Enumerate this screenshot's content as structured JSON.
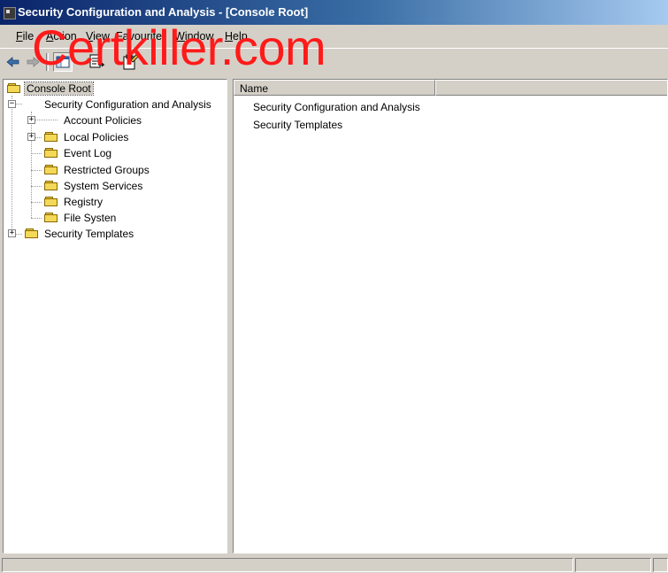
{
  "window": {
    "title": "Security Configuration and Analysis - [Console Root]"
  },
  "menubar": {
    "items": [
      "File",
      "Action",
      "View",
      "Favourite",
      "Window",
      "Help"
    ]
  },
  "toolbar": {
    "buttons": [
      "back-arrow-icon",
      "forward-arrow-icon",
      "show-hide-tree-icon",
      "export-list-icon",
      "properties-icon"
    ]
  },
  "watermark": {
    "text": "Certkiller.com",
    "color": "#ff1a1a"
  },
  "tree": {
    "root": "Console Root",
    "nodes": [
      "Security Configuration and Analysis",
      "Account Policies",
      "Local Policies",
      "Event Log",
      "Restricted Groups",
      "System Services",
      "Registry",
      "File Systen",
      "Security Templates"
    ]
  },
  "list": {
    "column_header": "Name",
    "rows": [
      "Security Configuration and Analysis",
      "Security Templates"
    ]
  },
  "colors": {
    "title_bar": "#0a246a",
    "window_face": "#d4d0c8",
    "folder": "#f4d858"
  }
}
